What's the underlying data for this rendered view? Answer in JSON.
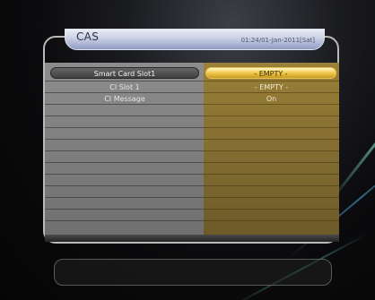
{
  "header": {
    "title": "CAS",
    "datetime": "01:24/01-Jan-2011[Sat]"
  },
  "menu": {
    "rows": [
      {
        "label": "Smart Card Slot1",
        "value": "- EMPTY -",
        "selected": true
      },
      {
        "label": "CI Slot 1",
        "value": "- EMPTY -",
        "selected": false
      },
      {
        "label": "CI Message",
        "value": "On",
        "selected": false
      }
    ]
  },
  "colors": {
    "highlight": "#f3cc52",
    "value_panel": "#9a8038",
    "label_panel": "#8d8d8d"
  }
}
